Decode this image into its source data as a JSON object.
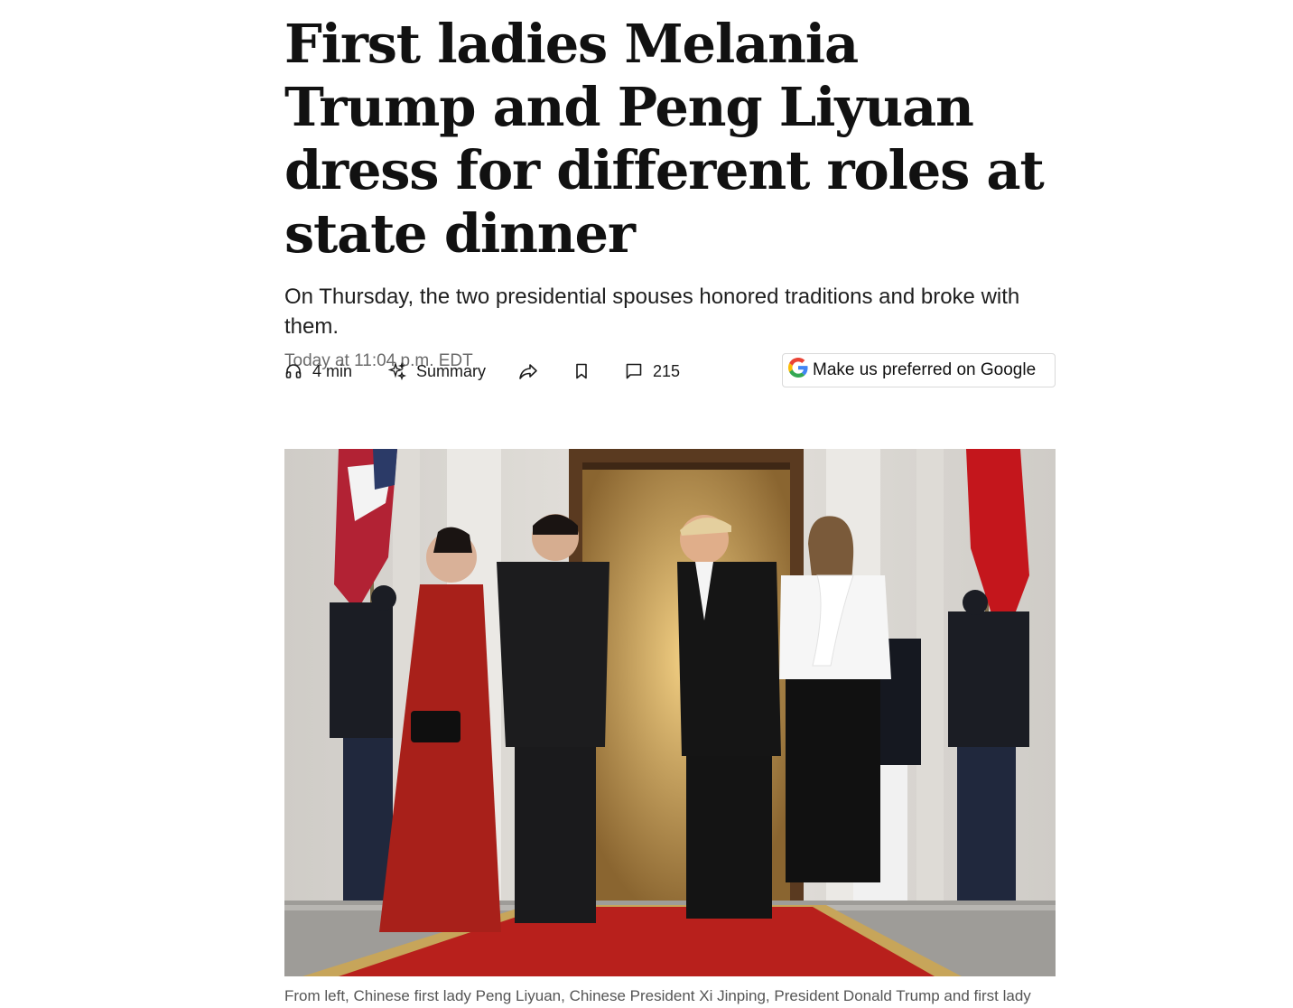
{
  "article": {
    "headline": "First ladies Melania Trump and Peng Liyuan dress for different roles at state dinner",
    "subheadline": "On Thursday, the two presidential spouses honored traditions and broke with them.",
    "timestamp": "Today at 11:04 p.m. EDT"
  },
  "toolbar": {
    "listen": {
      "icon": "headphones-icon",
      "label": "4 min"
    },
    "summary": {
      "icon": "sparkle-icon",
      "label": "Summary"
    },
    "share": {
      "icon": "share-icon"
    },
    "bookmark": {
      "icon": "bookmark-icon"
    },
    "comments": {
      "icon": "comment-icon",
      "label": "215"
    },
    "google_preferred": {
      "icon": "google-icon",
      "label": "Make us preferred on Google"
    }
  },
  "photo": {
    "caption": "From left, Chinese first lady Peng Liyuan, Chinese President Xi Jinping, President Donald Trump and first lady"
  },
  "colors": {
    "headline": "#111111",
    "timestamp": "#6b6b6b",
    "caption": "#555555",
    "carpet": "#b8201c",
    "google_blue": "#4285F4",
    "google_red": "#EA4335",
    "google_yellow": "#FBBC05",
    "google_green": "#34A853"
  }
}
